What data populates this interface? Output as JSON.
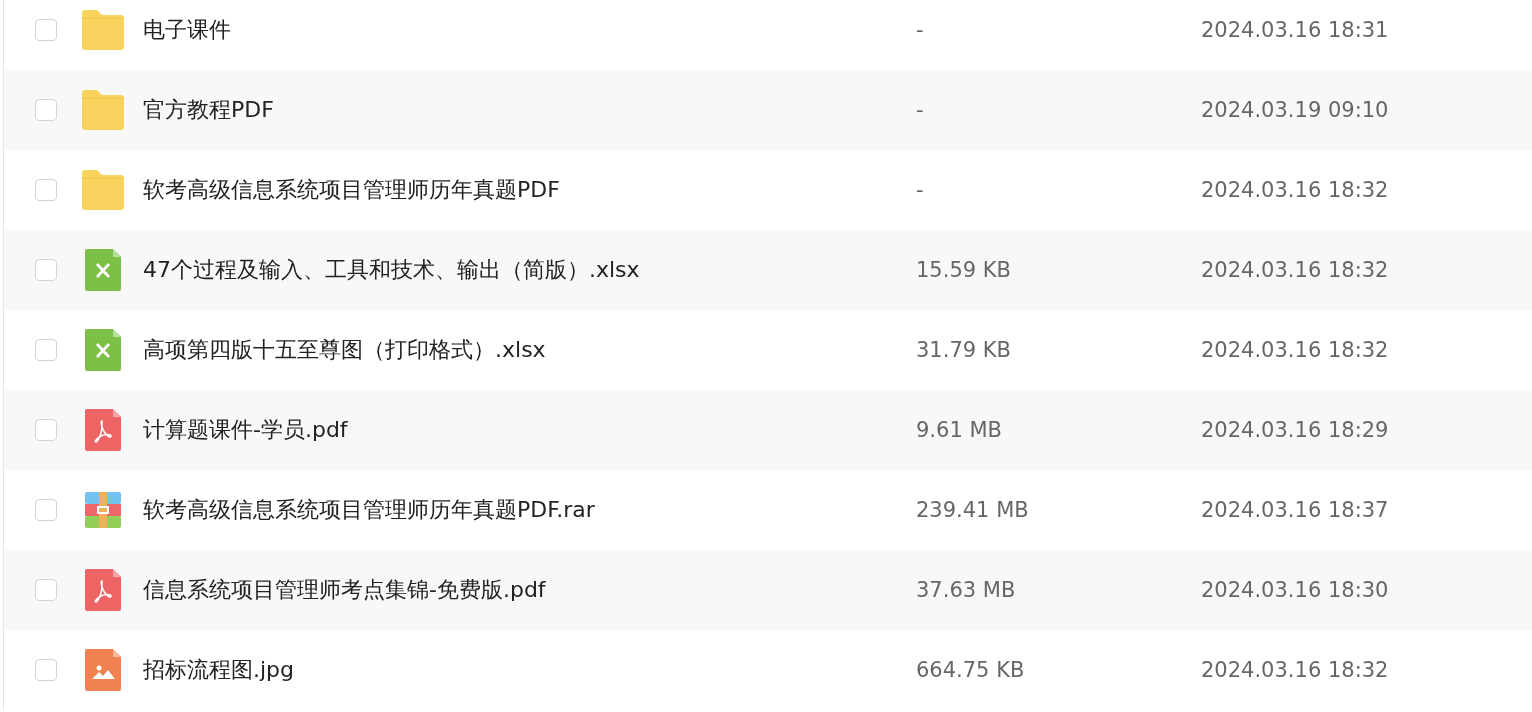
{
  "files": [
    {
      "kind": "folder",
      "name": "电子课件",
      "size": "-",
      "modified": "2024.03.16 18:31",
      "checked": false
    },
    {
      "kind": "folder",
      "name": "官方教程PDF",
      "size": "-",
      "modified": "2024.03.19 09:10",
      "checked": false
    },
    {
      "kind": "folder",
      "name": "软考高级信息系统项目管理师历年真题PDF",
      "size": "-",
      "modified": "2024.03.16 18:32",
      "checked": false
    },
    {
      "kind": "sheet",
      "name": "47个过程及输入、工具和技术、输出（简版）.xlsx",
      "size": "15.59 KB",
      "modified": "2024.03.16 18:32",
      "checked": false
    },
    {
      "kind": "sheet",
      "name": "高项第四版十五至尊图（打印格式）.xlsx",
      "size": "31.79 KB",
      "modified": "2024.03.16 18:32",
      "checked": false
    },
    {
      "kind": "pdf",
      "name": "计算题课件-学员.pdf",
      "size": "9.61 MB",
      "modified": "2024.03.16 18:29",
      "checked": false
    },
    {
      "kind": "archive",
      "name": "软考高级信息系统项目管理师历年真题PDF.rar",
      "size": "239.41 MB",
      "modified": "2024.03.16 18:37",
      "checked": false
    },
    {
      "kind": "pdf",
      "name": "信息系统项目管理师考点集锦-免费版.pdf",
      "size": "37.63 MB",
      "modified": "2024.03.16 18:30",
      "checked": false
    },
    {
      "kind": "image",
      "name": "招标流程图.jpg",
      "size": "664.75 KB",
      "modified": "2024.03.16 18:32",
      "checked": false
    }
  ]
}
